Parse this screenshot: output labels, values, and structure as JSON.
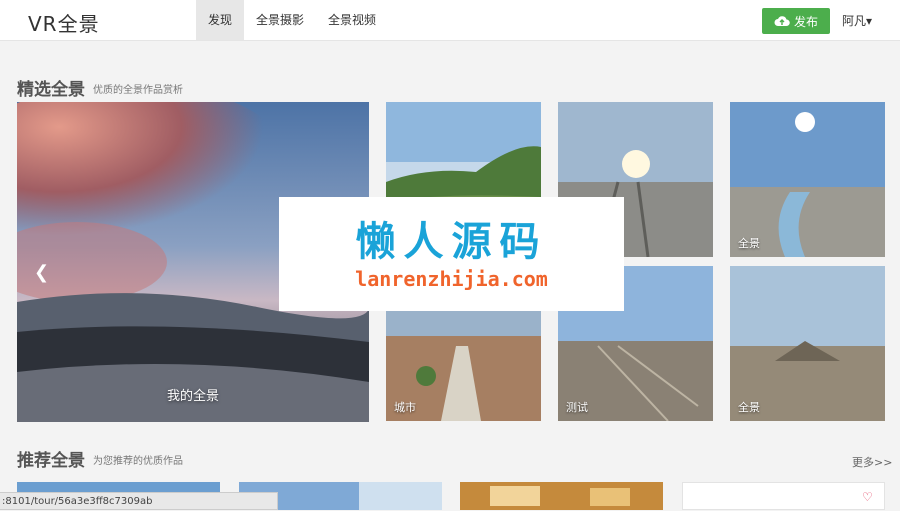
{
  "header": {
    "logo": "VR全景",
    "nav": [
      "发现",
      "全景摄影",
      "全景视频"
    ],
    "publish_label": "发布",
    "user_label": "阿凡▾"
  },
  "featured": {
    "title": "精选全景",
    "subtitle": "优质的全景作品赏析",
    "big_label": "我的全景",
    "tile_labels": [
      "全景",
      "城市",
      "测试",
      "全景"
    ]
  },
  "recommended": {
    "title": "推荐全景",
    "subtitle": "为您推荐的优质作品",
    "more": "更多>>"
  },
  "watermark": {
    "cn": "懒人源码",
    "en": "lanrenzhijia.com"
  },
  "status_url": ":8101/tour/56a3e3ff8c7309ab",
  "colors": {
    "publish_green": "#4cae4c",
    "watermark_blue": "#1aa3d8",
    "watermark_orange": "#f0642c"
  }
}
